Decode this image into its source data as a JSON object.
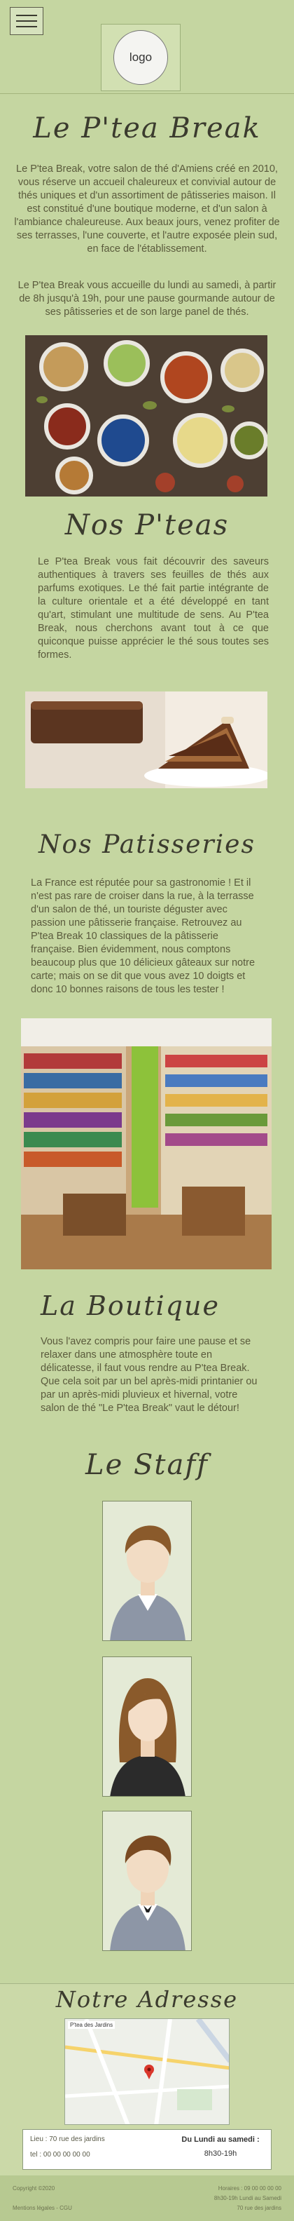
{
  "header": {
    "logo_text": "logo",
    "menu_icon": "hamburger-menu-icon"
  },
  "intro": {
    "title": "Le P'tea Break",
    "paragraph1": "Le P'tea Break, votre salon de thé d'Amiens créé en 2010, vous réserve un accueil chaleureux et convivial autour de thés uniques et d'un assortiment de pâtisseries maison. Il est constitué d'une boutique moderne, et d'un salon à l'ambiance chaleureuse. Aux beaux jours, venez profiter de ses terrasses, l'une couverte, et l'autre exposée plein sud, en face de l'établissement.",
    "paragraph2": "Le P'tea Break vous accueille du lundi au samedi, à partir de 8h jusqu'à 19h, pour une pause gourmande autour de ses pâtisseries et de son large panel de thés."
  },
  "teas": {
    "title": "Nos P'teas",
    "text": "Le P'tea Break vous fait découvrir des saveurs authentiques à travers ses feuilles de thés aux parfums exotiques. Le thé fait partie intégrante de la culture orientale et a été développé en tant qu'art, stimulant une multitude de sens. Au P'tea Break, nous cherchons avant tout à ce que quiconque puisse apprécier le thé sous toutes ses formes."
  },
  "pastries": {
    "title": "Nos Patisseries",
    "text": "La France est réputée pour sa gastronomie ! Et il n'est pas rare de croiser dans la rue, à la terrasse d'un salon de thé, un touriste déguster avec passion une pâtisserie française. Retrouvez au P'tea Break 10 classiques de la pâtisserie française. Bien évidemment, nous comptons beaucoup plus que 10 délicieux gâteaux sur notre carte; mais on se dit que vous avez 10 doigts et donc 10 bonnes raisons de tous les tester !"
  },
  "shop": {
    "title": "La Boutique",
    "text": "Vous l'avez compris pour faire une pause et se relaxer dans une atmosphère toute en délicatesse, il faut vous rendre au P'tea Break. Que cela soit par un bel après-midi printanier ou par un après-midi pluvieux et hivernal, votre salon de thé \"Le P'tea Break\" vaut le détour!"
  },
  "staff": {
    "title": "Le Staff"
  },
  "address": {
    "title": "Notre Adresse",
    "map_place": "P'tea des Jardins",
    "contact_line1": "Lieu : 70 rue des jardins",
    "contact_line2": "tel : 00 00 00 00 00",
    "hours_title": "Du Lundi au samedi :",
    "hours_value": "8h30-19h"
  },
  "footer": {
    "copyright": "Copyright ©2020",
    "credits": "Mentions légales - CGU",
    "hours_line1": "Horaires : 09 00 00 00 00",
    "hours_line2": "8h30-19h Lundi au Samedi",
    "address_line": "70 rue des jardins"
  }
}
